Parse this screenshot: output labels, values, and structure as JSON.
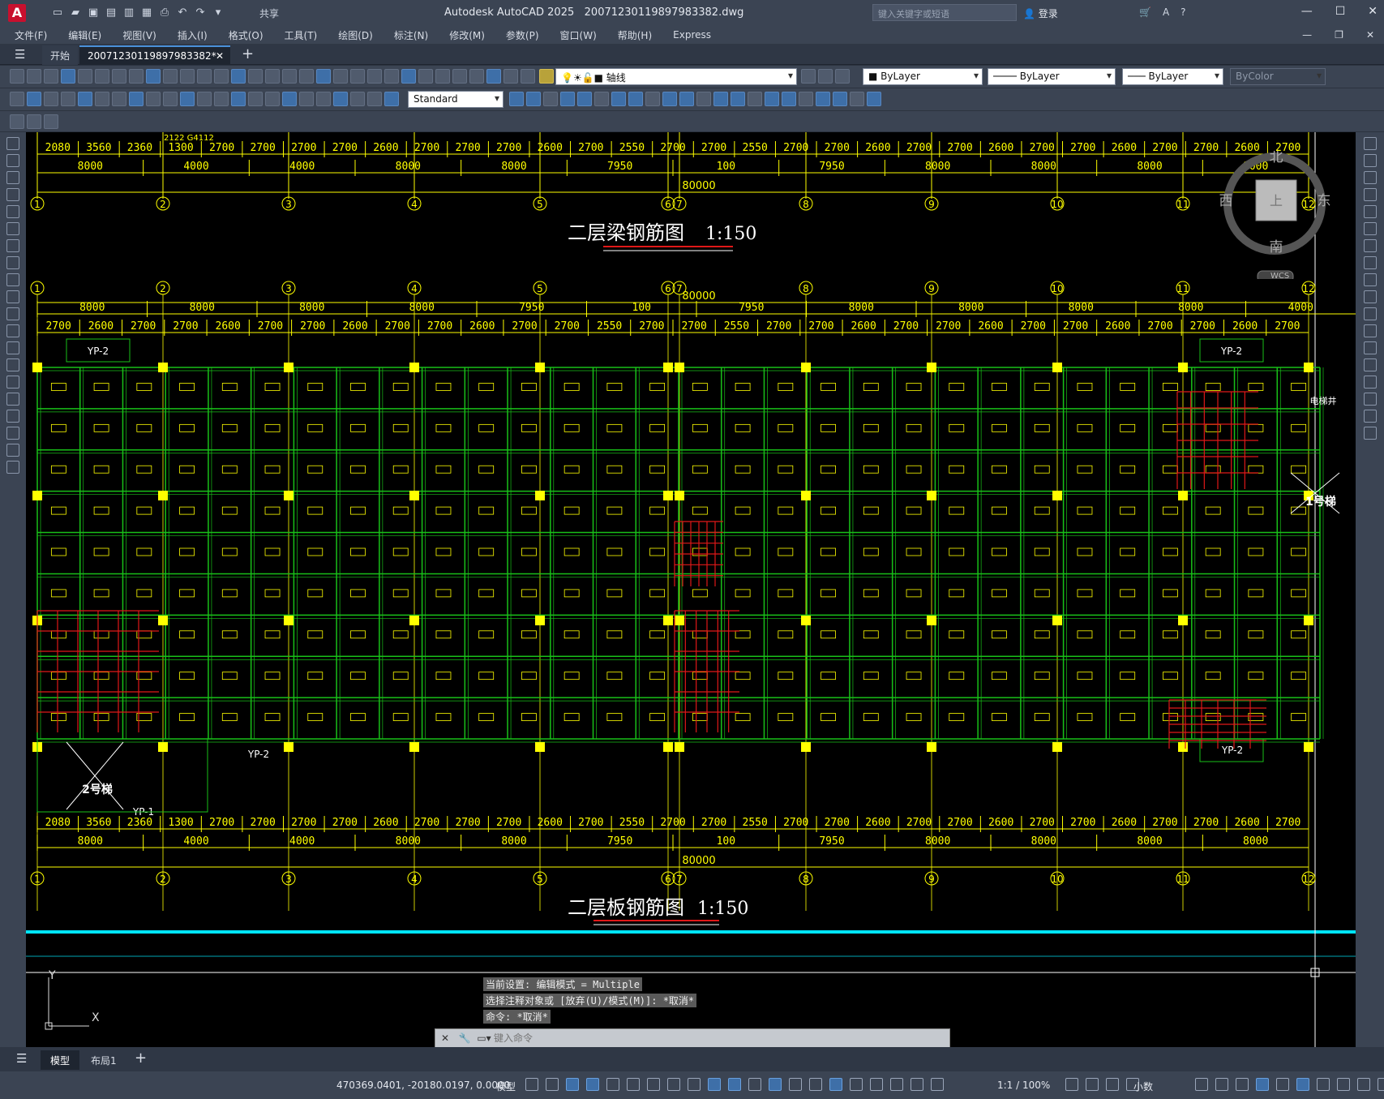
{
  "titlebar": {
    "app_title": "Autodesk AutoCAD 2025",
    "file_name": "20071230119897983382.dwg",
    "share_label": "共享",
    "search_placeholder": "键入关键字或短语",
    "login_label": "登录"
  },
  "menubar": {
    "items": [
      "文件(F)",
      "编辑(E)",
      "视图(V)",
      "插入(I)",
      "格式(O)",
      "工具(T)",
      "绘图(D)",
      "标注(N)",
      "修改(M)",
      "参数(P)",
      "窗口(W)",
      "帮助(H)",
      "Express"
    ]
  },
  "tabs": {
    "start": "开始",
    "drawing": "20071230119897983382*"
  },
  "properties": {
    "layer": "轴线",
    "color": "ByLayer",
    "linetype": "ByLayer",
    "lineweight": "ByLayer",
    "plotstyle": "ByColor",
    "text_style": "Standard"
  },
  "drawing": {
    "title_top": "二层梁钢筋图",
    "title_bottom": "二层板钢筋图",
    "scale": "1:150",
    "axis_labels": [
      "1",
      "2",
      "3",
      "4",
      "5",
      "6",
      "7",
      "8",
      "9",
      "10",
      "11",
      "12"
    ],
    "dim_top_row": [
      "2080",
      "3560",
      "2360",
      "1300",
      "2700",
      "2700",
      "2700",
      "2700",
      "2600",
      "2700",
      "2700",
      "2700",
      "2600",
      "2700",
      "2550",
      "2700",
      "2700",
      "2550",
      "2700",
      "2700",
      "2600",
      "2700",
      "2700",
      "2600",
      "2700",
      "2700",
      "2600",
      "2700",
      "2700",
      "2600",
      "2700"
    ],
    "dim_mid_row": [
      "8000",
      "4000",
      "4000",
      "8000",
      "8000",
      "7950",
      "100",
      "7950",
      "8000",
      "8000",
      "8000",
      "8000"
    ],
    "dim_total": "80000",
    "dim_upper_row": [
      "2700",
      "2600",
      "2700",
      "2700",
      "2600",
      "2700",
      "2700",
      "2600",
      "2700",
      "2700",
      "2600",
      "2700",
      "2700",
      "2550",
      "2700",
      "2700",
      "2550",
      "2700",
      "2700",
      "2600",
      "2700",
      "2700",
      "2600",
      "2700",
      "2700",
      "2600",
      "2700",
      "2700",
      "2600",
      "2700"
    ],
    "dim_upper_mid": [
      "8000",
      "8000",
      "8000",
      "8000",
      "7950",
      "100",
      "7950",
      "8000",
      "8000",
      "8000",
      "8000",
      "4000"
    ],
    "labels": {
      "yp2": "YP-2",
      "yp1": "YP-1",
      "stair2": "2号梯",
      "stair1": "1号梯",
      "elevator": "电梯井",
      "corner_top": "2122 G4112"
    }
  },
  "viewcube": {
    "north": "北",
    "south": "南",
    "east": "东",
    "west": "西",
    "top": "上",
    "wcs": "WCS"
  },
  "ucs": {
    "x": "X",
    "y": "Y"
  },
  "command": {
    "history": [
      "当前设置: 编辑模式 = Multiple",
      "选择注释对象或 [放弃(U)/模式(M)]: *取消*",
      "命令: *取消*"
    ],
    "placeholder": "键入命令"
  },
  "layouts": {
    "model": "模型",
    "layout1": "布局1"
  },
  "status": {
    "coords": "470369.0401, -20180.0197, 0.0000",
    "model": "模型",
    "scale": "1:1 / 100%",
    "units": "小数"
  }
}
